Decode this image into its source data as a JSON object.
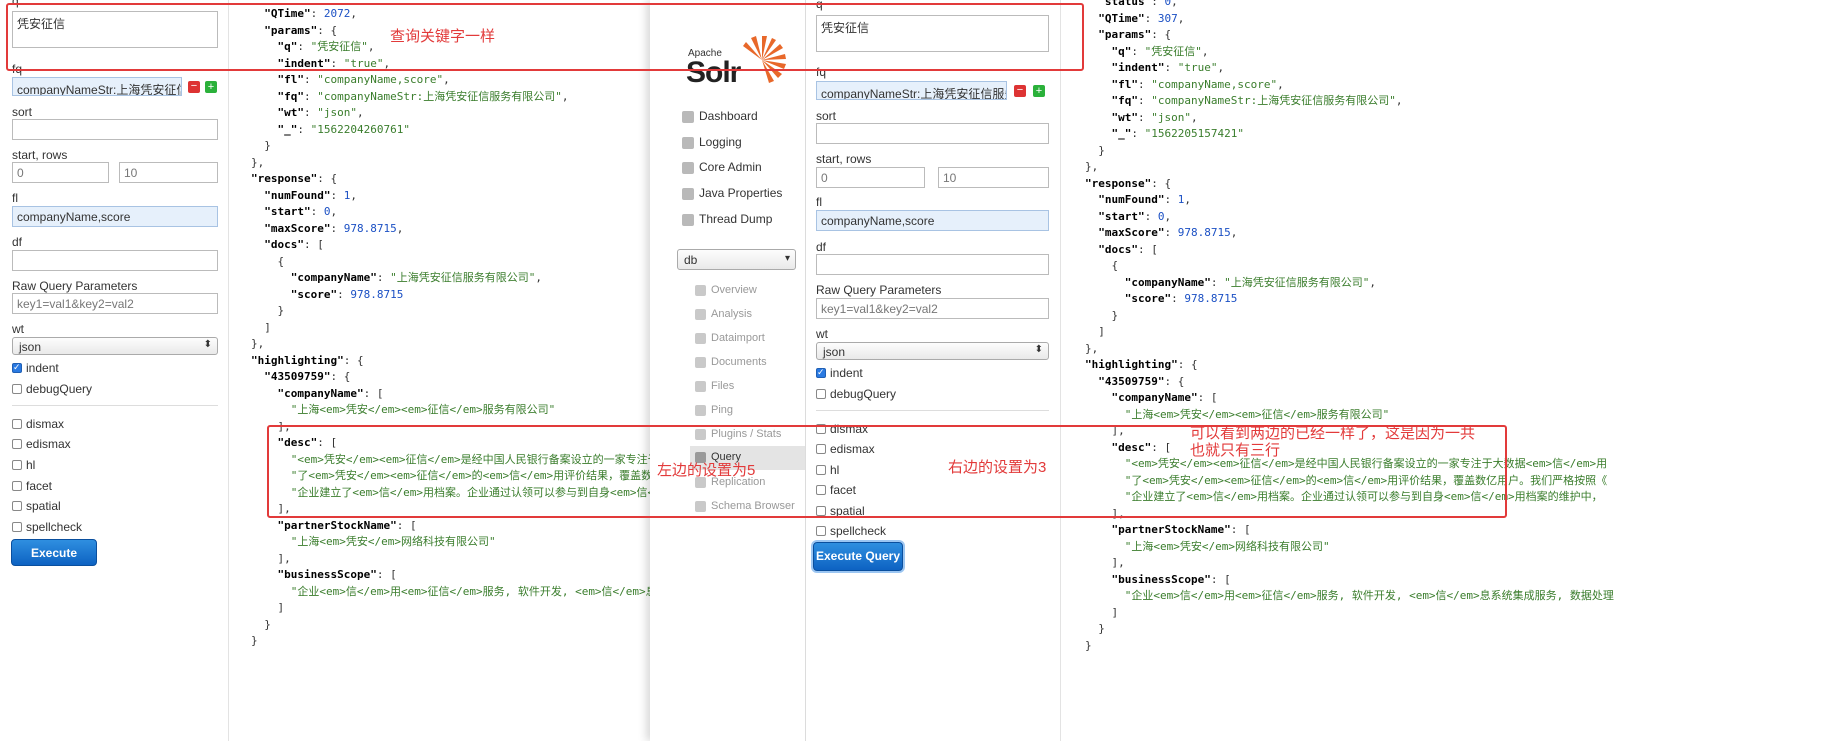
{
  "left_form": {
    "q_label": "q",
    "q_value": "凭安征信",
    "fq_label": "fq",
    "fq_value": "companyNameStr:上海凭安征信服务有限公司",
    "sort_label": "sort",
    "start_rows_label": "start, rows",
    "start_value": "0",
    "rows_value": "10",
    "fl_label": "fl",
    "fl_value": "companyName,score",
    "df_label": "df",
    "raw_label": "Raw Query Parameters",
    "raw_placeholder": "key1=val1&key2=val2",
    "wt_label": "wt",
    "wt_value": "json",
    "indent_label": "indent",
    "debug_label": "debugQuery",
    "dismax_label": "dismax",
    "edismax_label": "edismax",
    "hl_label": "hl",
    "facet_label": "facet",
    "spatial_label": "spatial",
    "spellcheck_label": "spellcheck",
    "execute_label": "Execute Query"
  },
  "left_response": [
    "  \"QTime\": 2072,",
    "  \"params\": {",
    "    \"q\": \"凭安征信\",",
    "    \"indent\": \"true\",",
    "    \"fl\": \"companyName,score\",",
    "    \"fq\": \"companyNameStr:上海凭安征信服务有限公司\",",
    "    \"wt\": \"json\",",
    "    \"_\": \"1562204260761\"",
    "  }",
    "},",
    "\"response\": {",
    "  \"numFound\": 1,",
    "  \"start\": 0,",
    "  \"maxScore\": 978.8715,",
    "  \"docs\": [",
    "    {",
    "      \"companyName\": \"上海凭安征信服务有限公司\",",
    "      \"score\": 978.8715",
    "    }",
    "  ]",
    "},",
    "\"highlighting\": {",
    "  \"43509759\": {",
    "    \"companyName\": [",
    "      \"上海<em>凭安</em><em>征信</em>服务有限公司\"",
    "    ],",
    "    \"desc\": [",
    "      \"<em>凭安</em><em>征信</em>是经中国人民银行备案设立的一家专注于大数",
    "      \"了<em>凭安</em><em>征信</em>的<em>信</em>用评价结果，覆盖数亿用户",
    "      \"企业建立了<em>信</em>用档案。企业通过认领可以参与到自身<em>信</em>",
    "    ],",
    "    \"partnerStockName\": [",
    "      \"上海<em>凭安</em>网络科技有限公司\"",
    "    ],",
    "    \"businessScope\": [",
    "      \"企业<em>信</em>用<em>征信</em>服务, 软件开发, <em>信</em>息系统集",
    "    ]",
    "  }",
    "}"
  ],
  "solr": {
    "apache": "Apache",
    "logo": "Solr",
    "nav": [
      "Dashboard",
      "Logging",
      "Core Admin",
      "Java Properties",
      "Thread Dump"
    ],
    "core_select": "db",
    "core_menu": [
      "Overview",
      "Analysis",
      "Dataimport",
      "Documents",
      "Files",
      "Ping",
      "Plugins / Stats",
      "Query",
      "Replication",
      "Schema Browser"
    ]
  },
  "right_form": {
    "q_label": "q",
    "q_value": "凭安征信",
    "fq_label": "fq",
    "fq_value": "companyNameStr:上海凭安征信服务有限公司",
    "sort_label": "sort",
    "start_rows_label": "start, rows",
    "start_value": "0",
    "rows_value": "10",
    "fl_label": "fl",
    "fl_value": "companyName,score",
    "df_label": "df",
    "raw_label": "Raw Query Parameters",
    "raw_placeholder": "key1=val1&key2=val2",
    "wt_label": "wt",
    "wt_value": "json",
    "indent_label": "indent",
    "debug_label": "debugQuery",
    "dismax_label": "dismax",
    "edismax_label": "edismax",
    "hl_label": "hl",
    "facet_label": "facet",
    "spatial_label": "spatial",
    "spellcheck_label": "spellcheck",
    "execute_label": "Execute Query"
  },
  "right_response": [
    "  \"status\": 0,",
    "  \"QTime\": 307,",
    "  \"params\": {",
    "    \"q\": \"凭安征信\",",
    "    \"indent\": \"true\",",
    "    \"fl\": \"companyName,score\",",
    "    \"fq\": \"companyNameStr:上海凭安征信服务有限公司\",",
    "    \"wt\": \"json\",",
    "    \"_\": \"1562205157421\"",
    "  }",
    "},",
    "\"response\": {",
    "  \"numFound\": 1,",
    "  \"start\": 0,",
    "  \"maxScore\": 978.8715,",
    "  \"docs\": [",
    "    {",
    "      \"companyName\": \"上海凭安征信服务有限公司\",",
    "      \"score\": 978.8715",
    "    }",
    "  ]",
    "},",
    "\"highlighting\": {",
    "  \"43509759\": {",
    "    \"companyName\": [",
    "      \"上海<em>凭安</em><em>征信</em>服务有限公司\"",
    "    ],",
    "    \"desc\": [",
    "      \"<em>凭安</em><em>征信</em>是经中国人民银行备案设立的一家专注于大数据<em>信</em>用",
    "      \"了<em>凭安</em><em>征信</em>的<em>信</em>用评价结果，覆盖数亿用户。我们严格按照《",
    "      \"企业建立了<em>信</em>用档案。企业通过认领可以参与到自身<em>信</em>用档案的维护中，",
    "    ],",
    "    \"partnerStockName\": [",
    "      \"上海<em>凭安</em>网络科技有限公司\"",
    "    ],",
    "    \"businessScope\": [",
    "      \"企业<em>信</em>用<em>征信</em>服务, 软件开发, <em>信</em>息系统集成服务, 数据处理",
    "    ]",
    "  }",
    "}"
  ],
  "annotations": {
    "keyword_same": "查询关键字一样",
    "left_setting": "左边的设置为5",
    "right_setting": "右边的设置为3",
    "explanation": "可以看到两边的已经一样了，这是因为一共\n也就只有三行",
    "red": "#e23a3a"
  }
}
